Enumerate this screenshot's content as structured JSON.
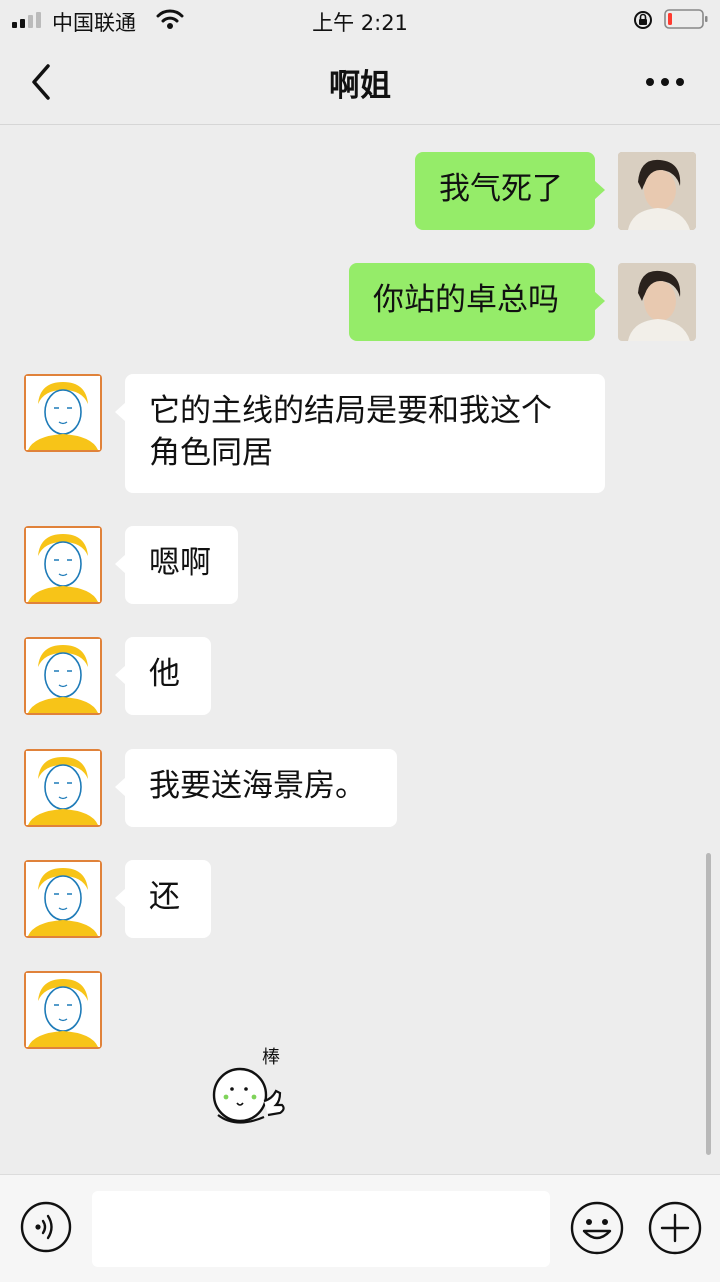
{
  "status_bar": {
    "carrier": "中国联通",
    "time": "上午 2:21"
  },
  "nav": {
    "title": "啊姐"
  },
  "messages": [
    {
      "from": "me",
      "text": "我气死了"
    },
    {
      "from": "me",
      "text": "你站的卓总吗"
    },
    {
      "from": "other",
      "text": "它的主线的结局是要和我这个角色同居"
    },
    {
      "from": "other",
      "text": "嗯啊"
    },
    {
      "from": "other",
      "text": "他"
    },
    {
      "from": "other",
      "text": "我要送海景房。"
    },
    {
      "from": "other",
      "text": "还"
    },
    {
      "from": "other",
      "sticker": "thumbs-up-face-sticker",
      "sticker_text": "棒"
    }
  ],
  "input": {
    "placeholder": ""
  },
  "icons": {
    "back": "chevron-left-icon",
    "more": "more-dots-icon",
    "voice": "voice-icon",
    "emoji": "emoji-icon",
    "plus": "plus-icon"
  },
  "colors": {
    "background": "#ededed",
    "my_bubble": "#95ec69",
    "their_bubble": "#ffffff"
  }
}
